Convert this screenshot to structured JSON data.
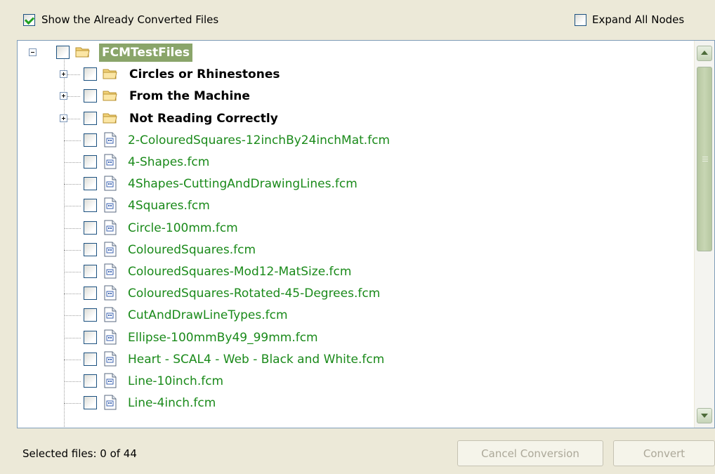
{
  "options": {
    "show_converted_label": "Show the Already Converted Files",
    "show_converted_checked": true,
    "expand_all_label": "Expand All Nodes",
    "expand_all_checked": false
  },
  "tree": {
    "root": {
      "label": "FCMTestFiles",
      "expanded": true
    },
    "folders": [
      {
        "label": "Circles or Rhinestones"
      },
      {
        "label": "From the Machine"
      },
      {
        "label": "Not Reading Correctly"
      }
    ],
    "files": [
      {
        "label": "2-ColouredSquares-12inchBy24inchMat.fcm"
      },
      {
        "label": "4-Shapes.fcm"
      },
      {
        "label": "4Shapes-CuttingAndDrawingLines.fcm"
      },
      {
        "label": "4Squares.fcm"
      },
      {
        "label": "Circle-100mm.fcm"
      },
      {
        "label": "ColouredSquares.fcm"
      },
      {
        "label": "ColouredSquares-Mod12-MatSize.fcm"
      },
      {
        "label": "ColouredSquares-Rotated-45-Degrees.fcm"
      },
      {
        "label": "CutAndDrawLineTypes.fcm"
      },
      {
        "label": "Ellipse-100mmBy49_99mm.fcm"
      },
      {
        "label": "Heart - SCAL4 - Web - Black and White.fcm"
      },
      {
        "label": "Line-10inch.fcm"
      },
      {
        "label": "Line-4inch.fcm"
      }
    ]
  },
  "status": {
    "selected_text": "Selected files: 0 of 44"
  },
  "buttons": {
    "cancel_label": "Cancel Conversion",
    "convert_label": "Convert"
  },
  "colors": {
    "file_text": "#1a8a1a",
    "root_highlight": "#8aa56a",
    "window_bg": "#ece9d8"
  }
}
